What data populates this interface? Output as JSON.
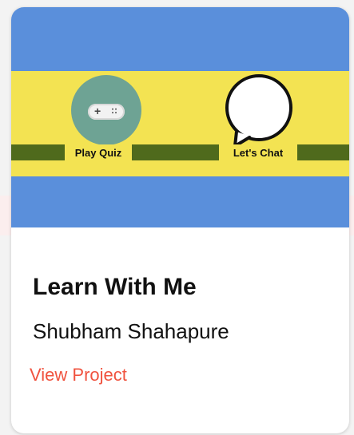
{
  "project": {
    "thumbnail": {
      "buttons": [
        {
          "label": "Play Quiz",
          "icon": "gamepad-icon"
        },
        {
          "label": "Let's Chat",
          "icon": "speech-bubble-icon"
        }
      ],
      "colors": {
        "sky": "#5a8fdb",
        "band": "#f3e352",
        "grass": "#4f6a1c",
        "quiz_circle": "#6ea394"
      }
    },
    "title": "Learn With Me",
    "author": "Shubham Shahapure",
    "link_label": "View Project",
    "link_color": "#f0533f"
  }
}
